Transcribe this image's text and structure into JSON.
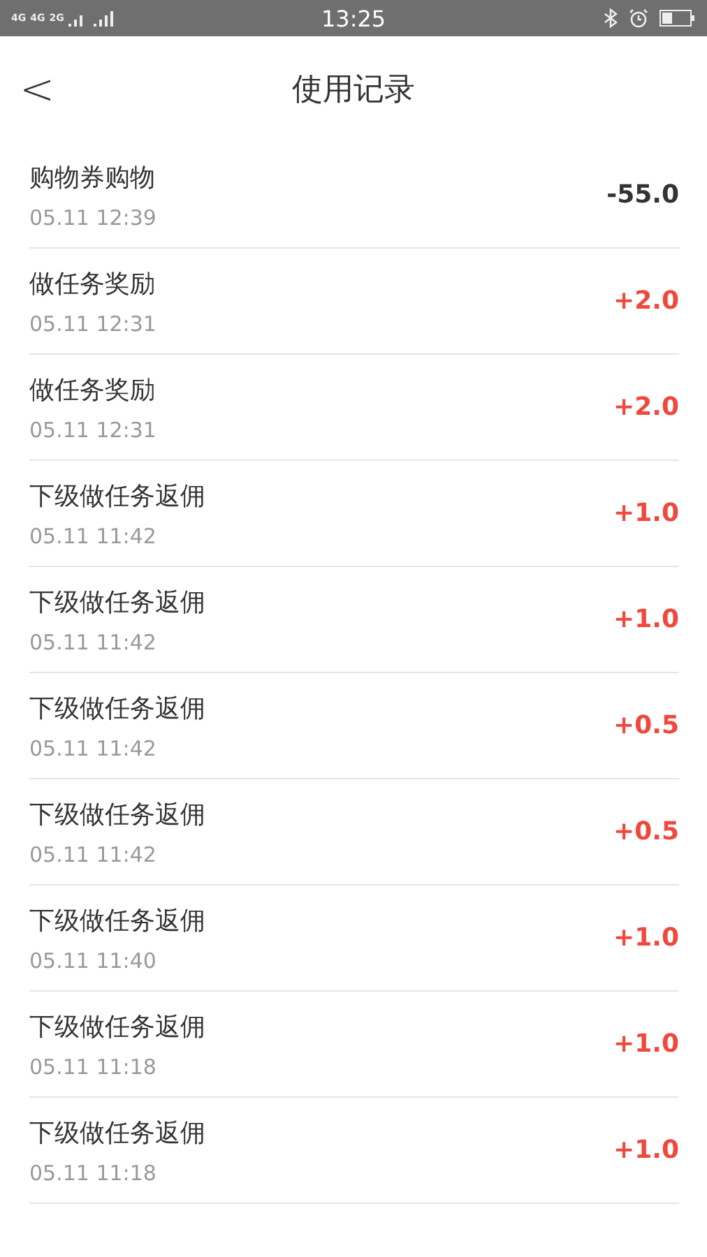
{
  "status_bar": {
    "network_1": "4G",
    "network_2": "4G",
    "network_3": "2G",
    "time": "13:25"
  },
  "header": {
    "back": "<",
    "title": "使用记录"
  },
  "records": [
    {
      "title": "购物券购物",
      "time": "05.11 12:39",
      "amount": "-55.0",
      "kind": "expense"
    },
    {
      "title": "做任务奖励",
      "time": "05.11 12:31",
      "amount": "+2.0",
      "kind": "income"
    },
    {
      "title": "做任务奖励",
      "time": "05.11 12:31",
      "amount": "+2.0",
      "kind": "income"
    },
    {
      "title": "下级做任务返佣",
      "time": "05.11 11:42",
      "amount": "+1.0",
      "kind": "income"
    },
    {
      "title": "下级做任务返佣",
      "time": "05.11 11:42",
      "amount": "+1.0",
      "kind": "income"
    },
    {
      "title": "下级做任务返佣",
      "time": "05.11 11:42",
      "amount": "+0.5",
      "kind": "income"
    },
    {
      "title": "下级做任务返佣",
      "time": "05.11 11:42",
      "amount": "+0.5",
      "kind": "income"
    },
    {
      "title": "下级做任务返佣",
      "time": "05.11 11:40",
      "amount": "+1.0",
      "kind": "income"
    },
    {
      "title": "下级做任务返佣",
      "time": "05.11 11:18",
      "amount": "+1.0",
      "kind": "income"
    },
    {
      "title": "下级做任务返佣",
      "time": "05.11 11:18",
      "amount": "+1.0",
      "kind": "income"
    }
  ]
}
